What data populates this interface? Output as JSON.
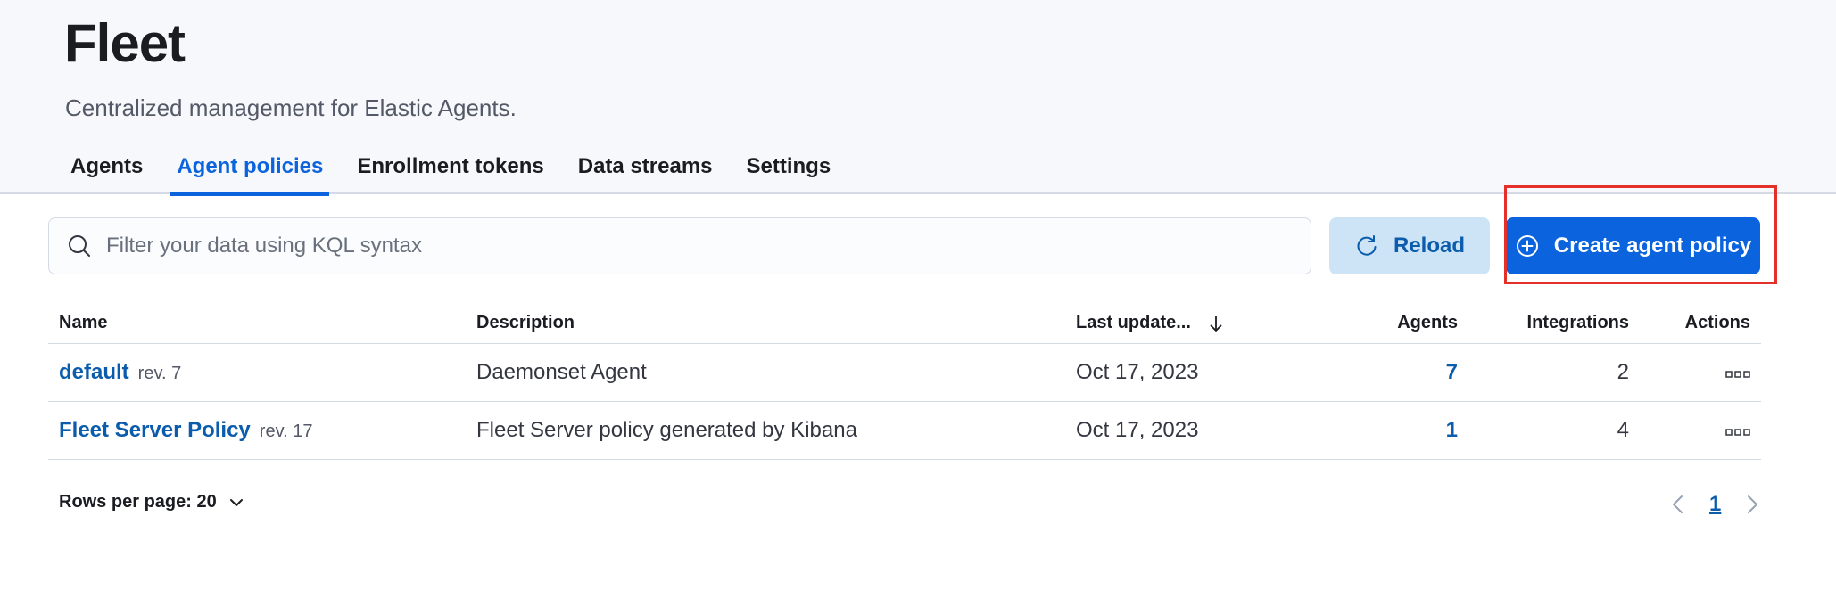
{
  "header": {
    "title": "Fleet",
    "subtitle": "Centralized management for Elastic Agents."
  },
  "tabs": [
    {
      "label": "Agents",
      "active": false
    },
    {
      "label": "Agent policies",
      "active": true
    },
    {
      "label": "Enrollment tokens",
      "active": false
    },
    {
      "label": "Data streams",
      "active": false
    },
    {
      "label": "Settings",
      "active": false
    }
  ],
  "toolbar": {
    "search_placeholder": "Filter your data using KQL syntax",
    "search_value": "",
    "search_icon": "search-icon",
    "reload_label": "Reload",
    "reload_icon": "refresh-icon",
    "create_label": "Create agent policy",
    "create_icon": "plus-circle-icon"
  },
  "table": {
    "columns": {
      "name": "Name",
      "description": "Description",
      "last_updated": "Last update...",
      "agents": "Agents",
      "integrations": "Integrations",
      "actions": "Actions"
    },
    "rows": [
      {
        "name": "default",
        "revision": "rev. 7",
        "description": "Daemonset Agent",
        "last_updated": "Oct 17, 2023",
        "agents": "7",
        "integrations": "2"
      },
      {
        "name": "Fleet Server Policy",
        "revision": "rev. 17",
        "description": "Fleet Server policy generated by Kibana",
        "last_updated": "Oct 17, 2023",
        "agents": "1",
        "integrations": "4"
      }
    ]
  },
  "pagination": {
    "rows_per_page": "Rows per page: 20",
    "current_page": "1"
  },
  "colors": {
    "accent": "#0b64dd",
    "link": "#0b5cad",
    "highlight_box": "#e5302a",
    "header_bg": "#f7f8fc"
  }
}
